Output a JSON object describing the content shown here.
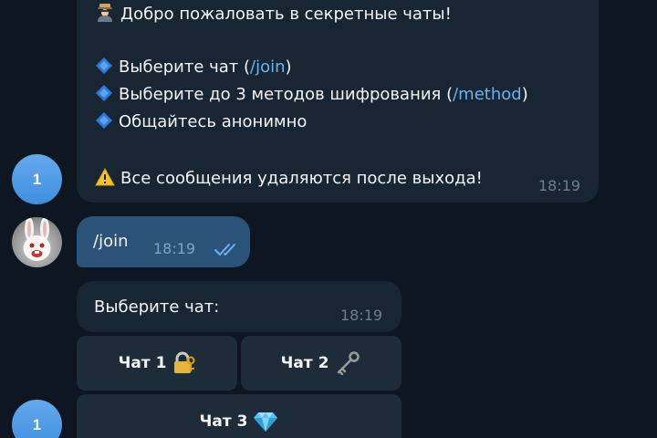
{
  "messages": {
    "welcome": {
      "title": "Добро пожаловать в секретные чаты!",
      "item1_prefix": "Выберите чат (",
      "item1_cmd": "/join",
      "item1_suffix": ")",
      "item2_prefix": "Выберите до 3 методов шифрования (",
      "item2_cmd": "/method",
      "item2_suffix": ")",
      "item3": "Общайтесь анонимно",
      "warning": "Все сообщения удаляются после выхода!",
      "time": "18:19",
      "title_icon": "detective-icon",
      "bullet_icon": "blue-diamond-icon",
      "warning_icon": "warning-icon"
    },
    "user_join": {
      "text": "/join",
      "time": "18:19",
      "status_icon": "double-check-icon"
    },
    "choose_chat": {
      "text": "Выберите чат:",
      "time": "18:19"
    }
  },
  "keyboard": {
    "chat1": {
      "label": "Чат 1",
      "icon": "locked-with-key-icon"
    },
    "chat2": {
      "label": "Чат 2",
      "icon": "old-key-icon"
    },
    "chat3": {
      "label": "Чат 3",
      "icon": "gem-icon"
    }
  },
  "avatars": {
    "bot_letter": "1",
    "bot_letter_2": "1"
  },
  "colors": {
    "background": "#0e1621",
    "incoming_bubble": "#182533",
    "outgoing_bubble": "#2b5278",
    "link": "#6ab3f3",
    "keyboard_button": "#1e2c3a"
  }
}
